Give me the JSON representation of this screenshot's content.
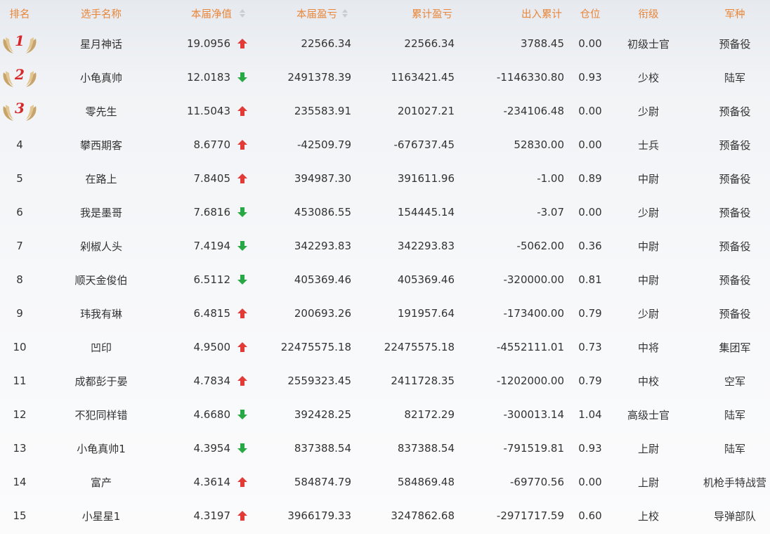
{
  "header": {
    "rank": "排名",
    "name": "选手名称",
    "net_value": "本届净值",
    "current_pnl": "本届盈亏",
    "cumulative_pnl": "累计盈亏",
    "cash_flow": "出入累计",
    "position": "仓位",
    "level": "衔级",
    "army": "军种"
  },
  "colors": {
    "header_text": "#e8863a",
    "arrow_up": "#e23a36",
    "arrow_down": "#27a844",
    "medal_number": "#d6282a",
    "wing": "#c8a46a"
  },
  "icons": {
    "up": "red-up-arrow-icon",
    "down": "green-down-arrow-icon",
    "medal": "winged-medal-icon",
    "sort": "sort-arrows-icon"
  },
  "rows": [
    {
      "rank": "1",
      "name": "星月神话",
      "net": "19.0956",
      "trend": "up",
      "cur": "22566.34",
      "cum": "22566.34",
      "flow": "3788.45",
      "pos": "0.00",
      "level": "初级士官",
      "army": "预备役"
    },
    {
      "rank": "2",
      "name": "小龟真帅",
      "net": "12.0183",
      "trend": "down",
      "cur": "2491378.39",
      "cum": "1163421.45",
      "flow": "-1146330.80",
      "pos": "0.93",
      "level": "少校",
      "army": "陆军"
    },
    {
      "rank": "3",
      "name": "零先生",
      "net": "11.5043",
      "trend": "up",
      "cur": "235583.91",
      "cum": "201027.21",
      "flow": "-234106.48",
      "pos": "0.00",
      "level": "少尉",
      "army": "预备役"
    },
    {
      "rank": "4",
      "name": "攀西期客",
      "net": "8.6770",
      "trend": "up",
      "cur": "-42509.79",
      "cum": "-676737.45",
      "flow": "52830.00",
      "pos": "0.00",
      "level": "士兵",
      "army": "预备役"
    },
    {
      "rank": "5",
      "name": "在路上",
      "net": "7.8405",
      "trend": "up",
      "cur": "394987.30",
      "cum": "391611.96",
      "flow": "-1.00",
      "pos": "0.89",
      "level": "中尉",
      "army": "预备役"
    },
    {
      "rank": "6",
      "name": "我是墨哥",
      "net": "7.6816",
      "trend": "down",
      "cur": "453086.55",
      "cum": "154445.14",
      "flow": "-3.07",
      "pos": "0.00",
      "level": "少尉",
      "army": "预备役"
    },
    {
      "rank": "7",
      "name": "剁椒人头",
      "net": "7.4194",
      "trend": "down",
      "cur": "342293.83",
      "cum": "342293.83",
      "flow": "-5062.00",
      "pos": "0.36",
      "level": "中尉",
      "army": "预备役"
    },
    {
      "rank": "8",
      "name": "顺天金俊伯",
      "net": "6.5112",
      "trend": "down",
      "cur": "405369.46",
      "cum": "405369.46",
      "flow": "-320000.00",
      "pos": "0.81",
      "level": "中尉",
      "army": "预备役"
    },
    {
      "rank": "9",
      "name": "玮我有琳",
      "net": "6.4815",
      "trend": "up",
      "cur": "200693.26",
      "cum": "191957.64",
      "flow": "-173400.00",
      "pos": "0.79",
      "level": "少尉",
      "army": "预备役"
    },
    {
      "rank": "10",
      "name": "凹印",
      "net": "4.9500",
      "trend": "up",
      "cur": "22475575.18",
      "cum": "22475575.18",
      "flow": "-4552111.01",
      "pos": "0.73",
      "level": "中将",
      "army": "集团军"
    },
    {
      "rank": "11",
      "name": "成都彭于晏",
      "net": "4.7834",
      "trend": "up",
      "cur": "2559323.45",
      "cum": "2411728.35",
      "flow": "-1202000.00",
      "pos": "0.79",
      "level": "中校",
      "army": "空军"
    },
    {
      "rank": "12",
      "name": "不犯同样错",
      "net": "4.6680",
      "trend": "down",
      "cur": "392428.25",
      "cum": "82172.29",
      "flow": "-300013.14",
      "pos": "1.04",
      "level": "高级士官",
      "army": "陆军"
    },
    {
      "rank": "13",
      "name": "小龟真帅1",
      "net": "4.3954",
      "trend": "down",
      "cur": "837388.54",
      "cum": "837388.54",
      "flow": "-791519.81",
      "pos": "0.93",
      "level": "上尉",
      "army": "陆军"
    },
    {
      "rank": "14",
      "name": "富产",
      "net": "4.3614",
      "trend": "up",
      "cur": "584874.79",
      "cum": "584869.48",
      "flow": "-69770.56",
      "pos": "0.00",
      "level": "上尉",
      "army": "机枪手特战营"
    },
    {
      "rank": "15",
      "name": "小星星1",
      "net": "4.3197",
      "trend": "up",
      "cur": "3966179.33",
      "cum": "3247862.68",
      "flow": "-2971717.59",
      "pos": "0.60",
      "level": "上校",
      "army": "导弹部队"
    }
  ]
}
